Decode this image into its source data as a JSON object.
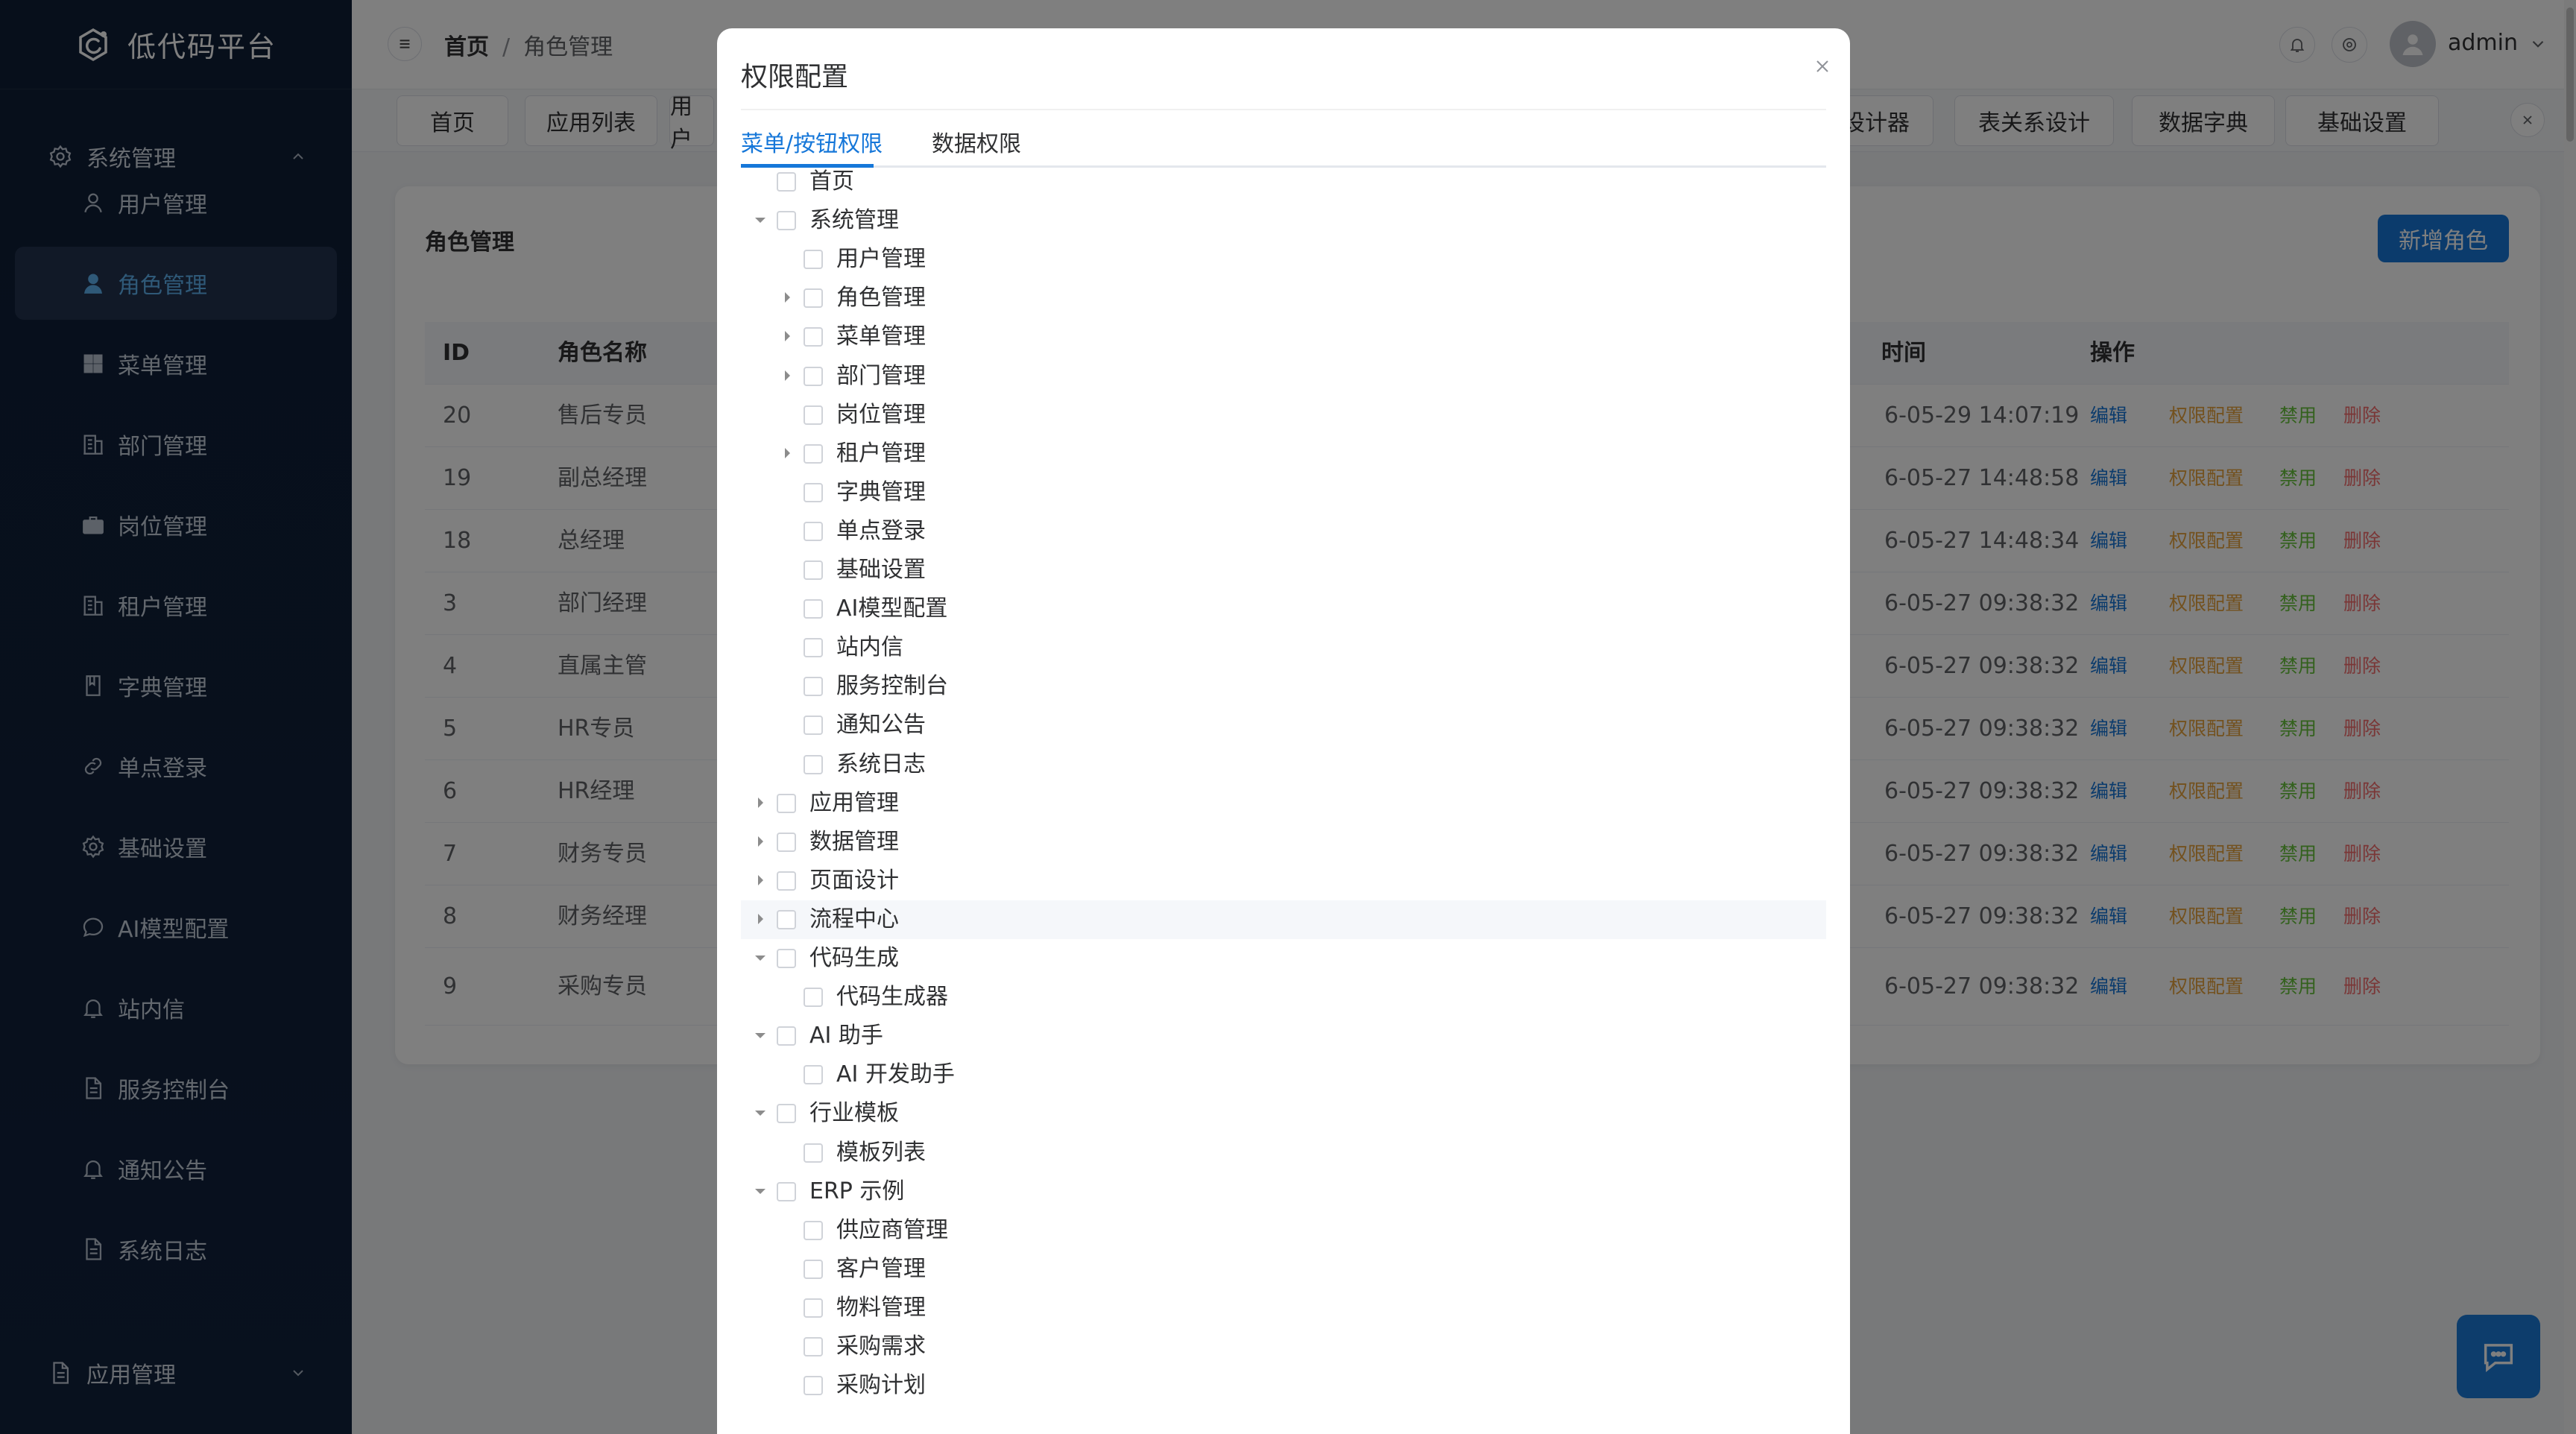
{
  "app": {
    "title": "低代码平台"
  },
  "sidebar": {
    "group_system": "系统管理",
    "group_app": "应用管理",
    "items": [
      {
        "label": "用户管理",
        "icon": "user-icon"
      },
      {
        "label": "角色管理",
        "icon": "user-filled-icon"
      },
      {
        "label": "菜单管理",
        "icon": "grid-icon"
      },
      {
        "label": "部门管理",
        "icon": "building-icon"
      },
      {
        "label": "岗位管理",
        "icon": "briefcase-icon"
      },
      {
        "label": "租户管理",
        "icon": "building-icon"
      },
      {
        "label": "字典管理",
        "icon": "book-icon"
      },
      {
        "label": "单点登录",
        "icon": "link-icon"
      },
      {
        "label": "基础设置",
        "icon": "gear-icon"
      },
      {
        "label": "AI模型配置",
        "icon": "chat-icon"
      },
      {
        "label": "站内信",
        "icon": "bell-icon"
      },
      {
        "label": "服务控制台",
        "icon": "document-icon"
      },
      {
        "label": "通知公告",
        "icon": "bell-icon"
      },
      {
        "label": "系统日志",
        "icon": "document-icon"
      }
    ]
  },
  "header": {
    "breadcrumb": {
      "home": "首页",
      "sep": "/",
      "current": "角色管理"
    },
    "username": "admin"
  },
  "tabs": [
    "首页",
    "应用列表",
    "用户",
    "设计器",
    "表关系设计",
    "数据字典",
    "基础设置"
  ],
  "main": {
    "title": "角色管理",
    "add_button": "新增角色",
    "columns": {
      "id": "ID",
      "name": "角色名称",
      "time": "时间",
      "ops": "操作"
    },
    "rows": [
      {
        "id": "20",
        "name": "售后专员",
        "time": "6-05-29 14:07:19"
      },
      {
        "id": "19",
        "name": "副总经理",
        "time": "6-05-27 14:48:58"
      },
      {
        "id": "18",
        "name": "总经理",
        "time": "6-05-27 14:48:34"
      },
      {
        "id": "3",
        "name": "部门经理",
        "time": "6-05-27 09:38:32"
      },
      {
        "id": "4",
        "name": "直属主管",
        "time": "6-05-27 09:38:32"
      },
      {
        "id": "5",
        "name": "HR专员",
        "time": "6-05-27 09:38:32"
      },
      {
        "id": "6",
        "name": "HR经理",
        "time": "6-05-27 09:38:32"
      },
      {
        "id": "7",
        "name": "财务专员",
        "time": "6-05-27 09:38:32"
      },
      {
        "id": "8",
        "name": "财务经理",
        "time": "6-05-27 09:38:32"
      },
      {
        "id": "9",
        "name": "采购专员",
        "time": "6-05-27 09:38:32"
      }
    ],
    "actions": {
      "edit": "编辑",
      "perm": "权限配置",
      "disable": "禁用",
      "delete": "删除"
    },
    "colors": {
      "edit": "#1677d9",
      "perm": "#e6a23c",
      "disable": "#67c23a",
      "delete": "#f56c6c"
    }
  },
  "modal": {
    "title": "权限配置",
    "tabs": [
      "菜单/按钮权限",
      "数据权限"
    ],
    "active_tab": "菜单/按钮权限",
    "tree": [
      {
        "label": "首页",
        "level": 0,
        "caret": "none"
      },
      {
        "label": "系统管理",
        "level": 0,
        "caret": "expanded"
      },
      {
        "label": "用户管理",
        "level": 1,
        "caret": "none"
      },
      {
        "label": "角色管理",
        "level": 1,
        "caret": "collapsed"
      },
      {
        "label": "菜单管理",
        "level": 1,
        "caret": "collapsed"
      },
      {
        "label": "部门管理",
        "level": 1,
        "caret": "collapsed"
      },
      {
        "label": "岗位管理",
        "level": 1,
        "caret": "none"
      },
      {
        "label": "租户管理",
        "level": 1,
        "caret": "collapsed"
      },
      {
        "label": "字典管理",
        "level": 1,
        "caret": "none"
      },
      {
        "label": "单点登录",
        "level": 1,
        "caret": "none"
      },
      {
        "label": "基础设置",
        "level": 1,
        "caret": "none"
      },
      {
        "label": "AI模型配置",
        "level": 1,
        "caret": "none"
      },
      {
        "label": "站内信",
        "level": 1,
        "caret": "none"
      },
      {
        "label": "服务控制台",
        "level": 1,
        "caret": "none"
      },
      {
        "label": "通知公告",
        "level": 1,
        "caret": "none"
      },
      {
        "label": "系统日志",
        "level": 1,
        "caret": "none"
      },
      {
        "label": "应用管理",
        "level": 0,
        "caret": "collapsed"
      },
      {
        "label": "数据管理",
        "level": 0,
        "caret": "collapsed"
      },
      {
        "label": "页面设计",
        "level": 0,
        "caret": "collapsed"
      },
      {
        "label": "流程中心",
        "level": 0,
        "caret": "collapsed",
        "hover": true
      },
      {
        "label": "代码生成",
        "level": 0,
        "caret": "expanded"
      },
      {
        "label": "代码生成器",
        "level": 1,
        "caret": "none"
      },
      {
        "label": "AI 助手",
        "level": 0,
        "caret": "expanded"
      },
      {
        "label": "AI 开发助手",
        "level": 1,
        "caret": "none"
      },
      {
        "label": "行业模板",
        "level": 0,
        "caret": "expanded"
      },
      {
        "label": "模板列表",
        "level": 1,
        "caret": "none"
      },
      {
        "label": "ERP 示例",
        "level": 0,
        "caret": "expanded"
      },
      {
        "label": "供应商管理",
        "level": 1,
        "caret": "none"
      },
      {
        "label": "客户管理",
        "level": 1,
        "caret": "none"
      },
      {
        "label": "物料管理",
        "level": 1,
        "caret": "none"
      },
      {
        "label": "采购需求",
        "level": 1,
        "caret": "none"
      },
      {
        "label": "采购计划",
        "level": 1,
        "caret": "none"
      }
    ]
  },
  "theme": {
    "primary": "#1677d9",
    "sidebar_bg": "#0f1e36",
    "active_item": "#5fb3f0"
  }
}
